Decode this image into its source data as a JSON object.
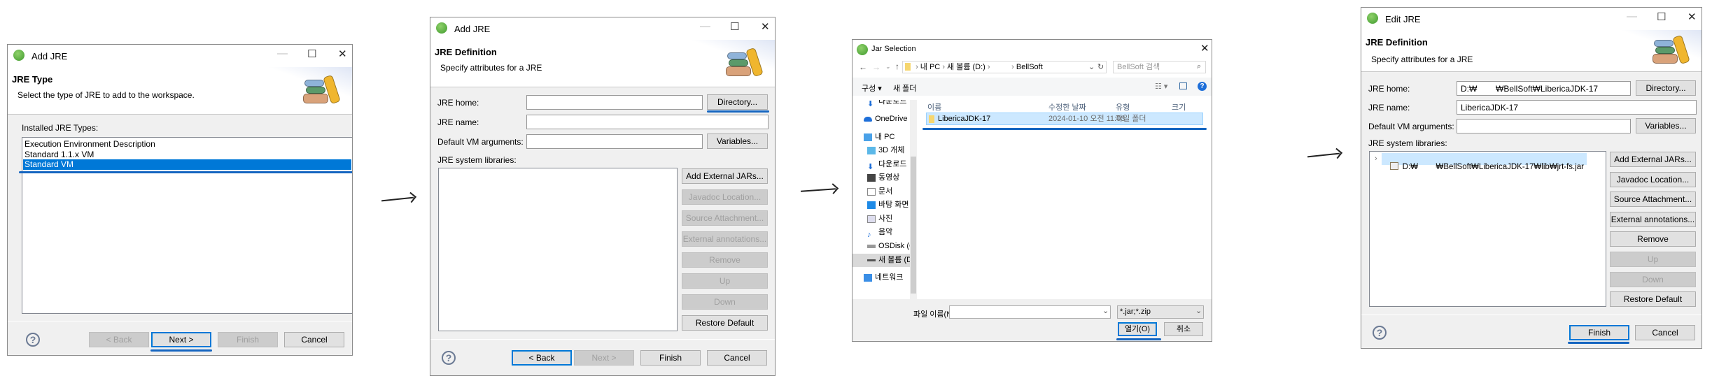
{
  "colors": {
    "accent": "#0078d7",
    "selection": "#0078d7",
    "annotation": "#1565c0",
    "row_highlight": "#cce8ff"
  },
  "step1": {
    "title": "Add JRE",
    "header_title": "JRE Type",
    "header_desc": "Select the type of JRE to add to the workspace.",
    "list_label": "Installed JRE Types:",
    "items": [
      "Execution Environment Description",
      "Standard 1.1.x VM",
      "Standard VM"
    ],
    "selected": "Standard VM",
    "buttons": {
      "back": "< Back",
      "next": "Next >",
      "finish": "Finish",
      "cancel": "Cancel"
    },
    "help": "?"
  },
  "step2": {
    "title": "Add JRE",
    "header_title": "JRE Definition",
    "header_desc": "Specify attributes for a JRE",
    "jre_home_label": "JRE home:",
    "jre_home_value": "",
    "jre_name_label": "JRE name:",
    "jre_name_value": "",
    "vm_args_label": "Default VM arguments:",
    "vm_args_value": "",
    "directory": "Directory...",
    "variables": "Variables...",
    "libs_label": "JRE system libraries:",
    "side_buttons": [
      "Add External JARs...",
      "Javadoc Location...",
      "Source Attachment...",
      "External annotations...",
      "Remove",
      "Up",
      "Down",
      "Restore Default"
    ],
    "buttons": {
      "back": "< Back",
      "next": "Next >",
      "finish": "Finish",
      "cancel": "Cancel"
    },
    "help": "?"
  },
  "step3": {
    "title": "Jar Selection",
    "breadcrumb": [
      "내 PC",
      "새 볼륨 (D:)",
      "BellSoft"
    ],
    "search_placeholder": "BellSoft 검색",
    "toolbar": {
      "organize": "구성 ▾",
      "new_folder": "새 폴더"
    },
    "nav": [
      "다운로드",
      "OneDrive - Pe",
      "내 PC",
      "3D 개체",
      "다운로드",
      "동영상",
      "문서",
      "바탕 화면",
      "사진",
      "음악",
      "OSDisk (C:)",
      "새 볼륨 (D:)",
      "네트워크"
    ],
    "columns": [
      "이름",
      "수정한 날짜",
      "유형",
      "크기"
    ],
    "rows": [
      {
        "name": "LibericaJDK-17",
        "date": "2024-01-10 오전 11:03",
        "type": "파일 폴더",
        "size": ""
      }
    ],
    "filename_label": "파일 이름(N):",
    "filename_value": "",
    "filter": "*.jar;*.zip",
    "open": "열기(O)",
    "cancel": "취소"
  },
  "step4": {
    "title": "Edit JRE",
    "header_title": "JRE Definition",
    "header_desc": "Specify attributes for a JRE",
    "jre_home_label": "JRE home:",
    "jre_home_value": "D:₩        ₩BellSoft₩LibericaJDK-17",
    "jre_name_label": "JRE name:",
    "jre_name_value": "LibericaJDK-17",
    "vm_args_label": "Default VM arguments:",
    "vm_args_value": "",
    "directory": "Directory...",
    "variables": "Variables...",
    "libs_label": "JRE system libraries:",
    "library": "D:₩        ₩BellSoft₩LibericaJDK-17₩lib₩jrt-fs.jar",
    "side_buttons": [
      "Add External JARs...",
      "Javadoc Location...",
      "Source Attachment...",
      "External annotations...",
      "Remove",
      "Up",
      "Down",
      "Restore Default"
    ],
    "buttons": {
      "finish": "Finish",
      "cancel": "Cancel"
    },
    "help": "?"
  }
}
